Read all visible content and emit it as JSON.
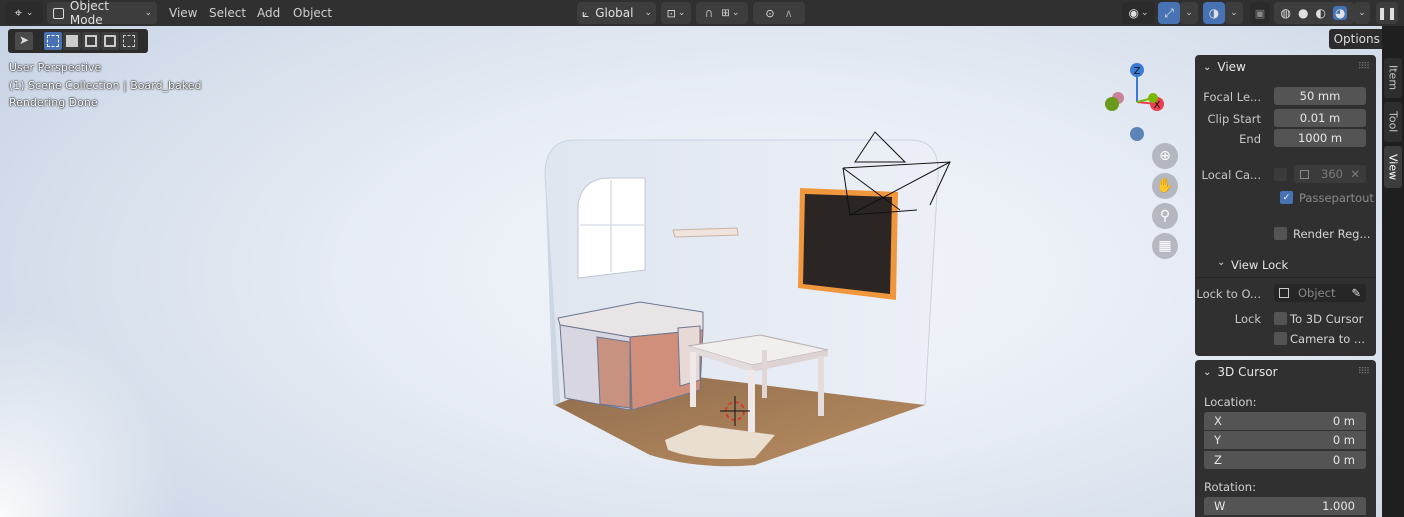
{
  "header": {
    "editor_type_icon": "3d-viewport-icon",
    "mode": "Object Mode",
    "menus": [
      "View",
      "Select",
      "Add",
      "Object"
    ],
    "transform_orientation": "Global",
    "shading_modes": [
      "wireframe",
      "solid",
      "material-preview",
      "rendered"
    ],
    "active_shading": "rendered"
  },
  "toolbar": {
    "options_label": "Options"
  },
  "viewport": {
    "perspective_label": "User Perspective",
    "collection_label": "(1) Scene Collection | Board_baked",
    "status_label": "Rendering Done",
    "gizmo_axes": {
      "x": "X",
      "y": "Y",
      "z": "Z"
    }
  },
  "sidebar_tabs": [
    "Item",
    "Tool",
    "View"
  ],
  "view_panel": {
    "title": "View",
    "focal_length_label": "Focal Le...",
    "focal_length_value": "50 mm",
    "clip_start_label": "Clip Start",
    "clip_start_value": "0.01 m",
    "end_label": "End",
    "end_value": "1000 m",
    "local_camera_label": "Local Ca...",
    "local_camera_value": "360",
    "passepartout_label": "Passepartout",
    "render_region_label": "Render Reg...",
    "view_lock_title": "View Lock",
    "lock_to_object_label": "Lock to O...",
    "lock_to_object_placeholder": "Object",
    "lock_label": "Lock",
    "to_3d_cursor_label": "To 3D Cursor",
    "camera_to_view_label": "Camera to ..."
  },
  "cursor_panel": {
    "title": "3D Cursor",
    "location_label": "Location:",
    "x_label": "X",
    "x_value": "0 m",
    "y_label": "Y",
    "y_value": "0 m",
    "z_label": "Z",
    "z_value": "0 m",
    "rotation_label": "Rotation:",
    "w_label": "W",
    "w_value": "1.000"
  },
  "colors": {
    "header_bg": "#303030",
    "accent_blue": "#4772b3",
    "selection_orange": "#f0963c",
    "axis_x": "#e8404f",
    "axis_y": "#7ab800",
    "axis_z": "#3b7bd6"
  }
}
